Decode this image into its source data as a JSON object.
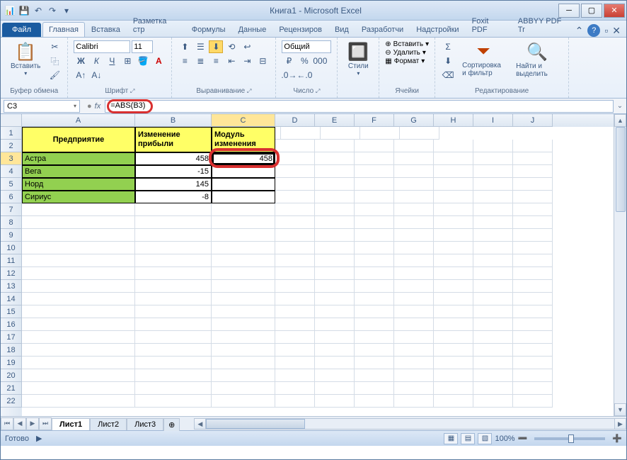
{
  "title": "Книга1 - Microsoft Excel",
  "qat": {
    "save": "💾",
    "undo": "↶",
    "redo": "↷"
  },
  "tabs": {
    "file": "Файл",
    "items": [
      "Главная",
      "Вставка",
      "Разметка стр",
      "Формулы",
      "Данные",
      "Рецензиров",
      "Вид",
      "Разработчи",
      "Надстройки",
      "Foxit PDF",
      "ABBYY PDF Tr"
    ],
    "active_index": 0
  },
  "ribbon": {
    "clipboard": {
      "paste": "Вставить",
      "label": "Буфер обмена"
    },
    "font": {
      "name": "Calibri",
      "size": "11",
      "label": "Шрифт"
    },
    "alignment": {
      "label": "Выравнивание"
    },
    "number": {
      "format": "Общий",
      "label": "Число"
    },
    "styles": {
      "name": "Стили"
    },
    "cells": {
      "insert": "Вставить",
      "delete": "Удалить",
      "format": "Формат",
      "label": "Ячейки"
    },
    "editing": {
      "sort": "Сортировка и фильтр",
      "find": "Найти и выделить",
      "label": "Редактирование"
    }
  },
  "formula_bar": {
    "cell_ref": "C3",
    "formula": "=ABS(B3)"
  },
  "columns": [
    "A",
    "B",
    "C",
    "D",
    "E",
    "F",
    "G",
    "H",
    "I",
    "J"
  ],
  "rows_visible": 22,
  "selected_cell": "C3",
  "sheet_data": {
    "header_merged_a": "Предприятие",
    "header_b": "Изменение прибыли",
    "header_c": "Модуль изменения",
    "rows": [
      {
        "a": "Астра",
        "b": "458",
        "c": "458"
      },
      {
        "a": "Вега",
        "b": "-15",
        "c": ""
      },
      {
        "a": "Норд",
        "b": "145",
        "c": ""
      },
      {
        "a": "Сириус",
        "b": "-8",
        "c": ""
      }
    ]
  },
  "sheet_tabs": {
    "items": [
      "Лист1",
      "Лист2",
      "Лист3"
    ],
    "active": 0
  },
  "status": {
    "ready": "Готово",
    "zoom": "100%"
  }
}
